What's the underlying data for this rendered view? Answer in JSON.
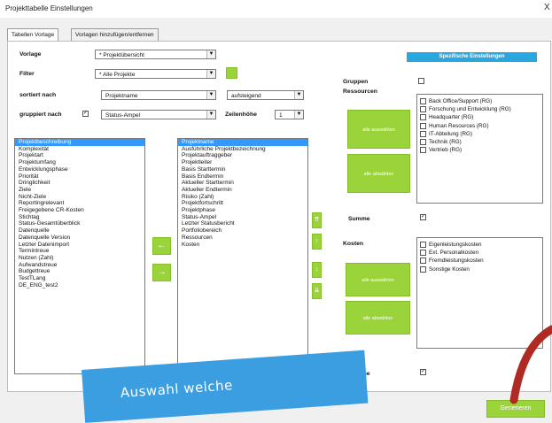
{
  "window": {
    "title": "Projekttabelle Einstellungen",
    "close_glyph": "X"
  },
  "tabs": [
    {
      "label": "Tabellen Vorlage"
    },
    {
      "label": "Vorlagen hinzufügen/entfernen"
    }
  ],
  "form": {
    "vorlage": {
      "label": "Vorlage",
      "value": "* Projektübersicht"
    },
    "filter": {
      "label": "Filter",
      "value": "* Alle Projekte"
    },
    "sort": {
      "label": "sortiert nach",
      "value": "Projektname",
      "order": "aufsteigend"
    },
    "group": {
      "label": "gruppiert nach",
      "checked": true,
      "value": "Status-Ampel"
    },
    "row_height": {
      "label": "Zeilenhöhe",
      "value": "1"
    }
  },
  "available_fields": {
    "items": [
      "Projektbeschreibung",
      "Komplexität",
      "Projektart",
      "Projektumfang",
      "Entwicklungsphase",
      "Priorität",
      "Dringlichkeit",
      "Ziele",
      "Nicht-Ziele",
      "Reportingrelevant",
      "Freigegebene CR-Kosten",
      "Stichtag",
      "Status-Gesamtüberblick",
      "Datenquelle",
      "Datenquelle Version",
      "Letzter Datenimport",
      "Termintreue",
      "Nutzen (Zahl)",
      "Aufwandstreue",
      "Budgettreue",
      "TestTLang",
      "DE_ENG_test2"
    ],
    "selected_index": 0
  },
  "selected_fields": {
    "items": [
      "Projektname",
      "Ausführliche Projektbezeichnung",
      "Projektauftraggeber",
      "Projektleiter",
      "Basis Starttermin",
      "Basis Endtermin",
      "Aktueller Starttermin",
      "Aktueller Endtermin",
      "Risiko (Zahl)",
      "Projektfortschritt",
      "Projektphase",
      "Status-Ampel",
      "Letzter Statusbericht",
      "Portfoliobereich",
      "Ressourcen",
      "Kosten"
    ],
    "selected_index": 0
  },
  "transfer_buttons": {
    "add": "→",
    "remove": "←"
  },
  "order_buttons": {
    "top": "⇈",
    "up": "↑",
    "down": "↓",
    "bottom": "⇊"
  },
  "special": {
    "header": "Spezifische Einstellungen",
    "gruppen": {
      "label": "Gruppen",
      "checked": false
    },
    "ressourcen": {
      "label": "Ressourcen",
      "select_all": "alle auswählen",
      "deselect_all": "alle abwählen",
      "items": [
        "Back Office/Support (RG)",
        "Forschung und Entwicklung (RG)",
        "Headquarter (RG)",
        "Human Resources (RG)",
        "IT-Abteilung (RG)",
        "Technik (RG)",
        "Vertrieb (RG)"
      ],
      "summe": {
        "label": "Summe",
        "checked": true
      }
    },
    "kosten": {
      "label": "Kosten",
      "select_all": "alle auswählen",
      "deselect_all": "alle abwählen",
      "items": [
        "Eigenleistungskosten",
        "Ext. Personalkosten",
        "Fremdleistungskosten",
        "Sonstige Kosten"
      ],
      "summe": {
        "label": "Summe",
        "checked": true
      }
    }
  },
  "generate_button": "Generieren",
  "annotation": {
    "text": "Auswahl welche"
  },
  "colors": {
    "accent_green": "#9bd33a",
    "header_blue": "#29a8e0",
    "selection_blue": "#3399ff",
    "note_blue": "#3a9ee0",
    "arc_red": "#b02a24"
  }
}
